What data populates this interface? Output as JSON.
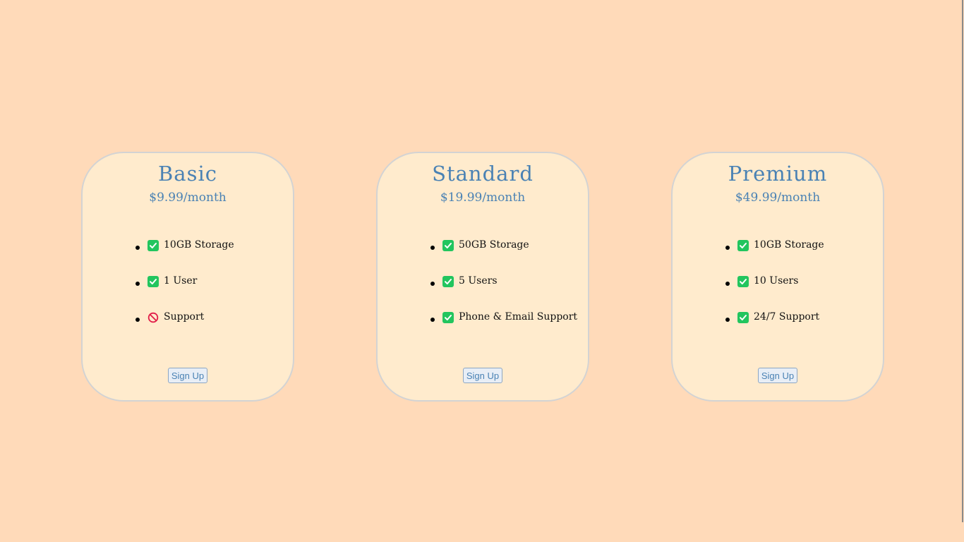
{
  "plans": [
    {
      "name": "Basic",
      "price": "$9.99/month",
      "features": [
        {
          "icon": "check-icon",
          "label": "10GB Storage"
        },
        {
          "icon": "check-icon",
          "label": "1 User"
        },
        {
          "icon": "prohibited-icon",
          "label": "Support"
        }
      ],
      "button_label": "Sign Up"
    },
    {
      "name": "Standard",
      "price": "$19.99/month",
      "features": [
        {
          "icon": "check-icon",
          "label": "50GB Storage"
        },
        {
          "icon": "check-icon",
          "label": "5 Users"
        },
        {
          "icon": "check-icon",
          "label": "Phone & Email Support"
        }
      ],
      "button_label": "Sign Up"
    },
    {
      "name": "Premium",
      "price": "$49.99/month",
      "features": [
        {
          "icon": "check-icon",
          "label": "10GB Storage"
        },
        {
          "icon": "check-icon",
          "label": "10 Users"
        },
        {
          "icon": "check-icon",
          "label": "24/7 Support"
        }
      ],
      "button_label": "Sign Up"
    }
  ],
  "colors": {
    "background": "#ffdab9",
    "card": "#ffebcd",
    "accent": "#4a82b4",
    "check": "#22c55e",
    "prohibited": "#e11d48"
  }
}
